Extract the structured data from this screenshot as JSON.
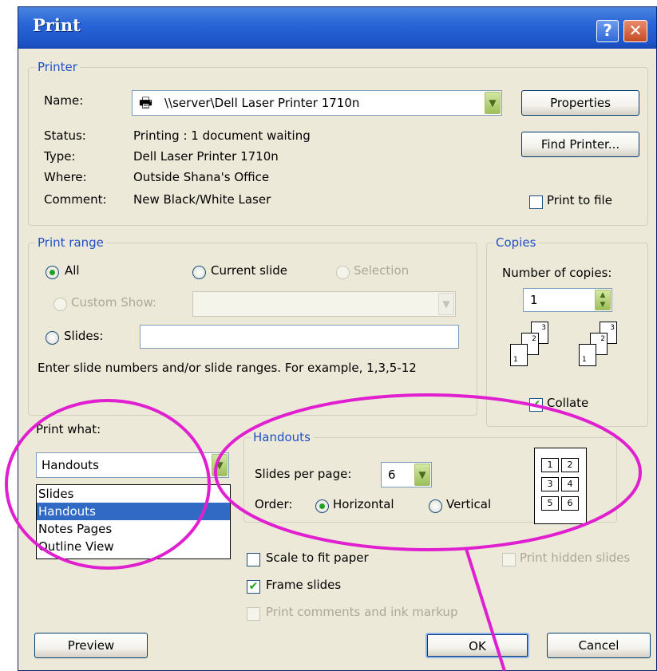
{
  "window": {
    "title": "Print"
  },
  "printer": {
    "legend": "Printer",
    "name_label": "Name:",
    "name_value": "\\\\server\\Dell Laser Printer 1710n",
    "status_label": "Status:",
    "status_value": "Printing : 1 document waiting",
    "type_label": "Type:",
    "type_value": "Dell Laser Printer 1710n",
    "where_label": "Where:",
    "where_value": "Outside Shana's Office",
    "comment_label": "Comment:",
    "comment_value": "New Black/White Laser",
    "properties_button": "Properties",
    "find_printer_button": "Find Printer...",
    "print_to_file_label": "Print to file"
  },
  "print_range": {
    "legend": "Print range",
    "all_label": "All",
    "current_slide_label": "Current slide",
    "selection_label": "Selection",
    "custom_show_label": "Custom Show:",
    "slides_label": "Slides:",
    "hint_text": "Enter slide numbers and/or slide ranges. For example, 1,3,5-12"
  },
  "copies": {
    "legend": "Copies",
    "number_label": "Number of copies:",
    "number_value": "1",
    "collate_label": "Collate"
  },
  "print_what": {
    "label": "Print what:",
    "selected": "Handouts",
    "options": [
      "Slides",
      "Handouts",
      "Notes Pages",
      "Outline View"
    ]
  },
  "handouts": {
    "legend": "Handouts",
    "slides_per_page_label": "Slides per page:",
    "slides_per_page_value": "6",
    "order_label": "Order:",
    "horizontal_label": "Horizontal",
    "vertical_label": "Vertical",
    "preview_numbers": [
      "1",
      "2",
      "3",
      "4",
      "5",
      "6"
    ]
  },
  "options": {
    "scale_to_fit_label": "Scale to fit paper",
    "frame_slides_label": "Frame slides",
    "print_comments_label": "Print comments and ink markup",
    "print_hidden_label": "Print hidden slides"
  },
  "buttons": {
    "preview": "Preview",
    "ok": "OK",
    "cancel": "Cancel"
  },
  "colors": {
    "annotation": "#E020D0",
    "titlebar": "#2966D7",
    "group_legend": "#1E4FC8"
  }
}
